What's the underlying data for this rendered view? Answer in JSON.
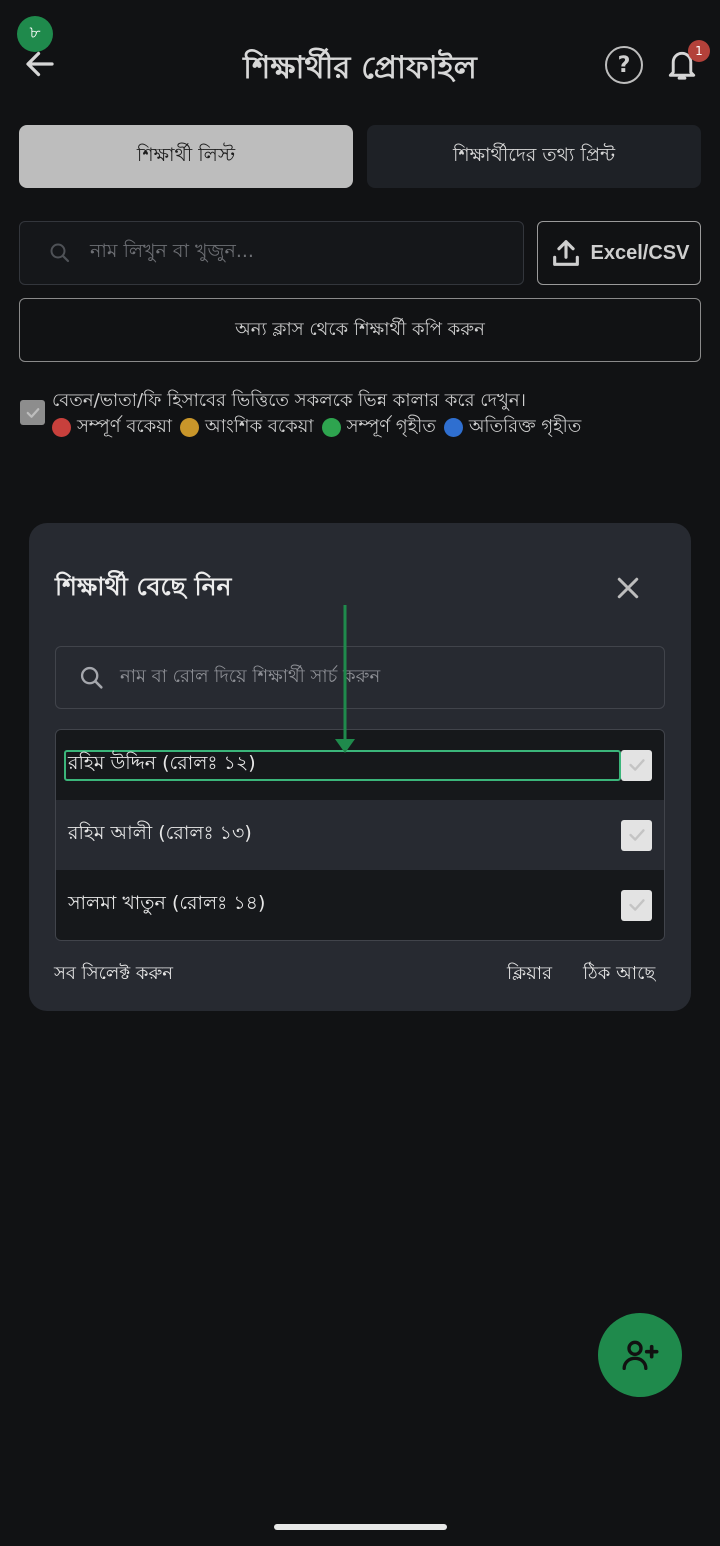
{
  "header": {
    "step_badge": "৮",
    "title": "শিক্ষার্থীর প্রোফাইল",
    "help_label": "?",
    "notification_count": "1"
  },
  "tabs": [
    {
      "label": "শিক্ষার্থী লিস্ট",
      "active": true
    },
    {
      "label": "শিক্ষার্থীদের তথ্য প্রিন্ট",
      "active": false
    }
  ],
  "search": {
    "placeholder": "নাম লিখুন বা খুজুন..."
  },
  "upload": {
    "label": "Excel/CSV"
  },
  "copy_button": {
    "label": "অন্য ক্লাস থেকে শিক্ষার্থী কপি করুন"
  },
  "legend": {
    "description": "বেতন/ভাতা/ফি হিসাবের ভিত্তিতে সকলকে ভিন্ন কালার করে দেখুন।",
    "items": [
      {
        "label": "সম্পূর্ণ বকেয়া",
        "color": "#c8403c"
      },
      {
        "label": "আংশিক বকেয়া",
        "color": "#c9962a"
      },
      {
        "label": "সম্পূর্ণ গৃহীত",
        "color": "#2ea44f"
      },
      {
        "label": "অতিরিক্ত গৃহীত",
        "color": "#2f6fd0"
      }
    ]
  },
  "modal": {
    "title": "শিক্ষার্থী বেছে নিন",
    "search_placeholder": "নাম বা রোল দিয়ে শিক্ষার্থী সার্চ করুন",
    "students": [
      {
        "label": "রহিম উদ্দিন (রোলঃ ১২)"
      },
      {
        "label": "রহিম আলী (রোলঃ ১৩)"
      },
      {
        "label": "সালমা খাতুন (রোলঃ ১৪)"
      }
    ],
    "select_all": "সব সিলেক্ট করুন",
    "clear": "ক্লিয়ার",
    "ok": "ঠিক আছে"
  },
  "colors": {
    "accent": "#1f8a4c",
    "highlight": "#3bb57a"
  }
}
